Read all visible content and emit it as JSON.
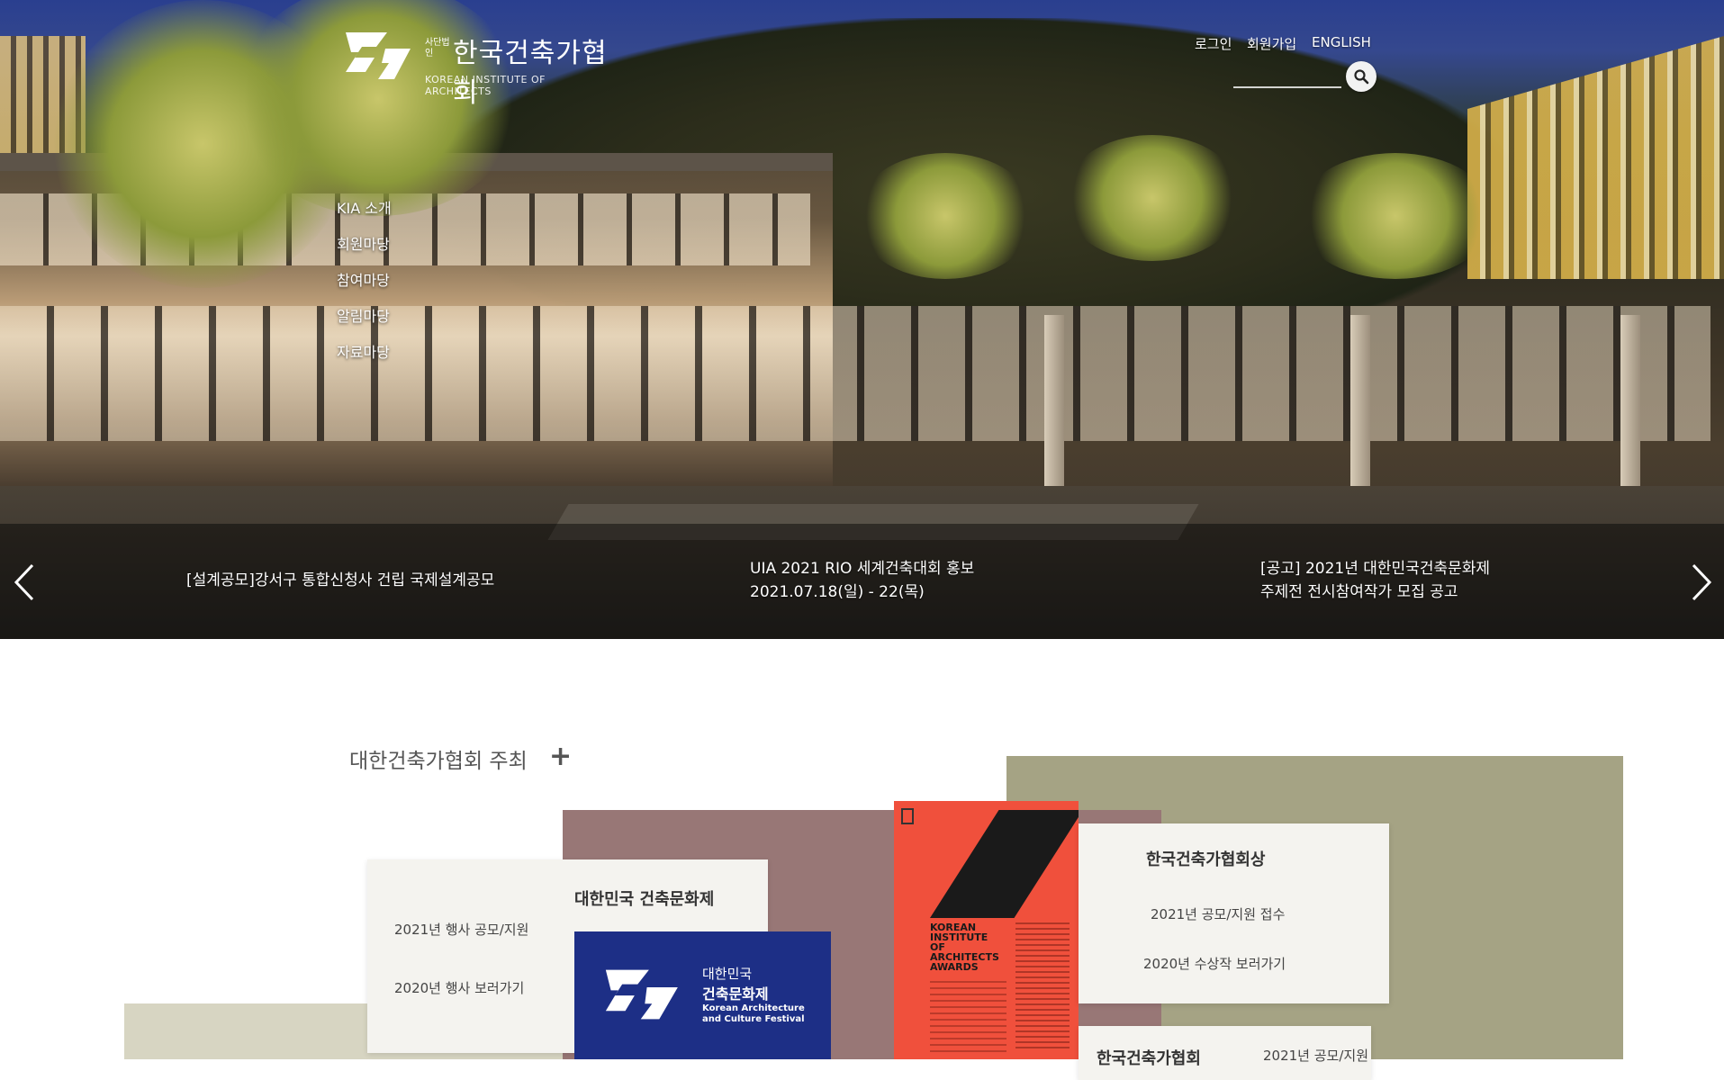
{
  "header": {
    "logo": {
      "small_label": "사단법인",
      "name": "한국건축가협회",
      "english": "KOREAN INSTITUTE OF ARCHITECTS"
    },
    "utility_links": [
      "로그인",
      "회원가입",
      "ENGLISH"
    ],
    "search": {
      "placeholder": ""
    }
  },
  "side_menu": [
    "KIA 소개",
    "회원마당",
    "참여마당",
    "알림마당",
    "자료마당"
  ],
  "slider": {
    "captions": [
      {
        "line1": "[설계공모]강서구 통합신청사 건립 국제설계공모",
        "line2": ""
      },
      {
        "line1": "UIA 2021 RIO 세계건축대회 홍보",
        "line2": "2021.07.18(일) - 22(목)"
      },
      {
        "line1": "[공고] 2021년 대한민국건축문화제",
        "line2": "주제전 전시참여작가 모집 공고"
      }
    ],
    "prev_icon": "chevron-left-icon",
    "next_icon": "chevron-right-icon"
  },
  "events": {
    "section_title": "대한건축가협회 주최",
    "more_icon": "plus-icon",
    "festival": {
      "title": "대한민국 건축문화제",
      "links": [
        "2021년 행사 공모/지원",
        "2020년 행사 보러가기"
      ],
      "logo_line1": "대한민국",
      "logo_line2": "건축문화제",
      "logo_line3": "Korean Architecture and Culture Festival"
    },
    "awards": {
      "title": "한국건축가협회상",
      "links": [
        "2021년 공모/지원 접수",
        "2020년 수상작 보러가기"
      ],
      "poster_text": "KOREAN INSTITUTE OF ARCHITECTS AWARDS"
    },
    "bottom_card": {
      "title": "한국건축가협회",
      "link": "2021년 공모/지원"
    }
  },
  "colors": {
    "festival_blue": "#1d2f86",
    "poster_red": "#f0503c",
    "olive": "#a5a384",
    "mauve": "#987776",
    "beige": "#d7d5c2"
  }
}
